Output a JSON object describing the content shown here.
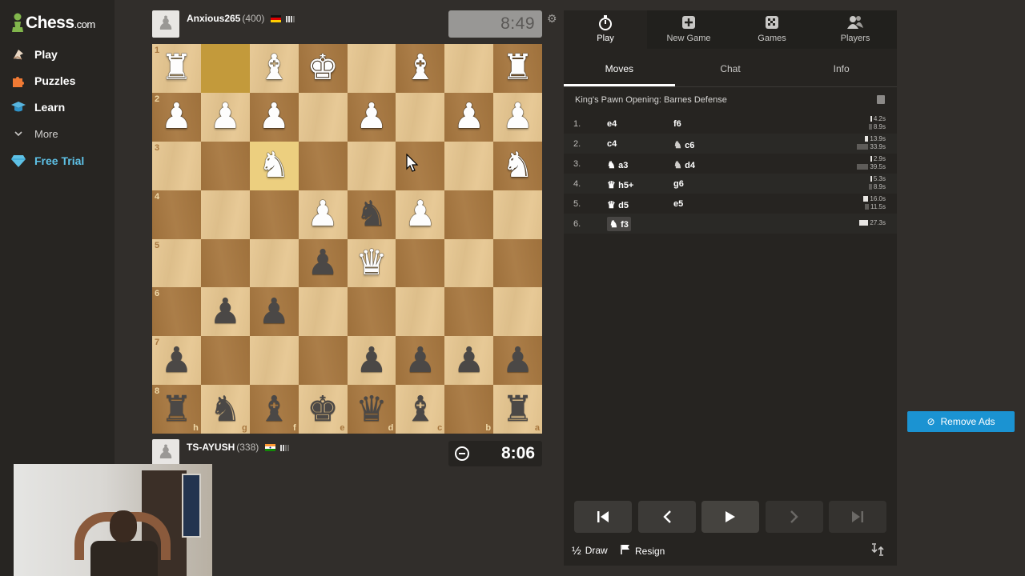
{
  "brand": {
    "name": "Chess",
    "suffix": ".com"
  },
  "sidebar": {
    "items": [
      {
        "label": "Play",
        "icon": "play-hand-icon"
      },
      {
        "label": "Puzzles",
        "icon": "puzzle-icon"
      },
      {
        "label": "Learn",
        "icon": "graduation-cap-icon"
      },
      {
        "label": "More",
        "icon": "chevron-down-icon"
      },
      {
        "label": "Free Trial",
        "icon": "diamond-icon"
      }
    ]
  },
  "players": {
    "top": {
      "name": "Anxious265",
      "rating": "(400)",
      "clock": "8:49",
      "flag": "Germany"
    },
    "bottom": {
      "name": "TS-AYUSH",
      "rating": "(338)",
      "clock": "8:06",
      "flag": "India"
    }
  },
  "board": {
    "orientation": "black",
    "ranks": [
      "1",
      "2",
      "3",
      "4",
      "5",
      "6",
      "7",
      "8"
    ],
    "files": [
      "h",
      "g",
      "f",
      "e",
      "d",
      "c",
      "b",
      "a"
    ],
    "rows": [
      [
        "wR",
        "",
        "wB",
        "wK",
        "",
        "wB",
        "",
        "wR"
      ],
      [
        "wP",
        "wP",
        "wP",
        "",
        "wP",
        "",
        "wP",
        "wP"
      ],
      [
        "",
        "",
        "wN",
        "",
        "",
        "",
        "",
        "wN"
      ],
      [
        "",
        "",
        "",
        "wP",
        "bN",
        "wP",
        "",
        ""
      ],
      [
        "",
        "",
        "",
        "bP",
        "wQ",
        "",
        "",
        ""
      ],
      [
        "",
        "bP",
        "bP",
        "",
        "",
        "",
        "",
        ""
      ],
      [
        "bP",
        "",
        "",
        "",
        "bP",
        "bP",
        "bP",
        "bP"
      ],
      [
        "bR",
        "bN",
        "bB",
        "bK",
        "bQ",
        "bB",
        "",
        "bR"
      ]
    ],
    "highlighted": [
      [
        0,
        1
      ],
      [
        2,
        2
      ]
    ]
  },
  "panel": {
    "tabs": [
      {
        "label": "Play",
        "icon": "stopwatch-icon"
      },
      {
        "label": "New Game",
        "icon": "plus-icon"
      },
      {
        "label": "Games",
        "icon": "board-icon"
      },
      {
        "label": "Players",
        "icon": "people-icon"
      }
    ],
    "subtabs": [
      "Moves",
      "Chat",
      "Info"
    ],
    "opening": "King's Pawn Opening: Barnes Defense",
    "moves": [
      {
        "num": "1.",
        "white": "e4",
        "black": "f6",
        "wt": "4.2s",
        "bt": "8.9s",
        "wfrac": 0.12,
        "bfrac": 0.26
      },
      {
        "num": "2.",
        "white": "c4",
        "black": "c6",
        "black_piece": "knight",
        "wt": "13.9s",
        "bt": "33.9s",
        "wfrac": 0.3,
        "bfrac": 1.0
      },
      {
        "num": "3.",
        "white": "a3",
        "white_piece": "knight",
        "black": "d4",
        "black_piece": "knight",
        "wt": "2.9s",
        "bt": "39.5s",
        "wfrac": 0.08,
        "bfrac": 1.0
      },
      {
        "num": "4.",
        "white": "h5+",
        "white_piece": "queen",
        "black": "g6",
        "wt": "5.3s",
        "bt": "8.9s",
        "wfrac": 0.15,
        "bfrac": 0.26
      },
      {
        "num": "5.",
        "white": "d5",
        "white_piece": "queen",
        "black": "e5",
        "wt": "16.0s",
        "bt": "11.5s",
        "wfrac": 0.45,
        "bfrac": 0.33
      },
      {
        "num": "6.",
        "white": "f3",
        "white_piece": "knight",
        "black": "",
        "wt": "27.3s",
        "bt": "",
        "wfrac": 0.8,
        "bfrac": 0
      }
    ],
    "draw_label": "Draw",
    "draw_glyph": "½",
    "resign_label": "Resign"
  },
  "ads": {
    "remove_label": "Remove Ads"
  },
  "colors": {
    "accent": "#1b93d2",
    "light_square": "#e6c690",
    "dark_square": "#a7773f",
    "bg": "#312e2b"
  }
}
